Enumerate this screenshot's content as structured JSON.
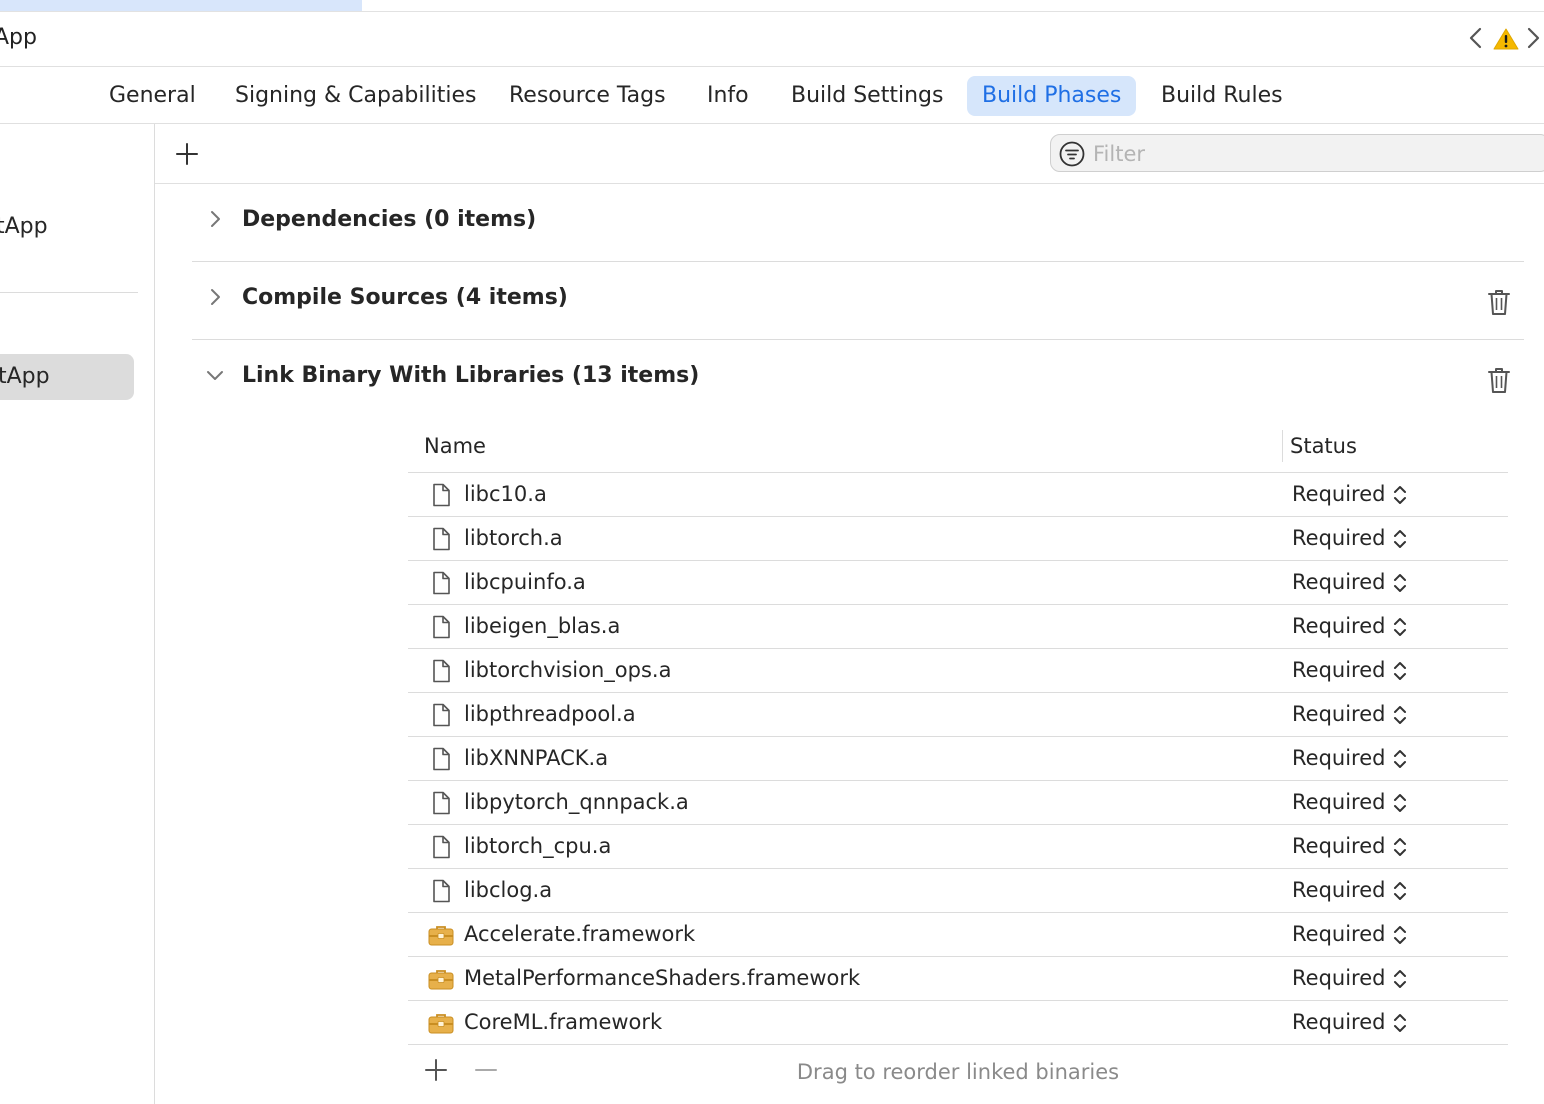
{
  "window": {
    "title": "App"
  },
  "tabs": [
    {
      "label": "General",
      "active": false
    },
    {
      "label": "Signing & Capabilities",
      "active": false
    },
    {
      "label": "Resource Tags",
      "active": false
    },
    {
      "label": "Info",
      "active": false
    },
    {
      "label": "Build Settings",
      "active": false
    },
    {
      "label": "Build Phases",
      "active": true
    },
    {
      "label": "Build Rules",
      "active": false
    }
  ],
  "sidebar": {
    "project_label": "tApp",
    "target_label": "tApp"
  },
  "toolbar": {
    "filter_placeholder": "Filter"
  },
  "phases": {
    "dependencies": {
      "title": "Dependencies (0 items)",
      "expanded": false
    },
    "compile_sources": {
      "title": "Compile Sources (4 items)",
      "expanded": false
    },
    "link_binary": {
      "title": "Link Binary With Libraries (13 items)",
      "expanded": true
    }
  },
  "library_table": {
    "columns": {
      "name": "Name",
      "status": "Status"
    },
    "rows": [
      {
        "name": "libc10.a",
        "status": "Required",
        "icon": "document-icon"
      },
      {
        "name": "libtorch.a",
        "status": "Required",
        "icon": "document-icon"
      },
      {
        "name": "libcpuinfo.a",
        "status": "Required",
        "icon": "document-icon"
      },
      {
        "name": "libeigen_blas.a",
        "status": "Required",
        "icon": "document-icon"
      },
      {
        "name": "libtorchvision_ops.a",
        "status": "Required",
        "icon": "document-icon"
      },
      {
        "name": "libpthreadpool.a",
        "status": "Required",
        "icon": "document-icon"
      },
      {
        "name": "libXNNPACK.a",
        "status": "Required",
        "icon": "document-icon"
      },
      {
        "name": "libpytorch_qnnpack.a",
        "status": "Required",
        "icon": "document-icon"
      },
      {
        "name": "libtorch_cpu.a",
        "status": "Required",
        "icon": "document-icon"
      },
      {
        "name": "libclog.a",
        "status": "Required",
        "icon": "document-icon"
      },
      {
        "name": "Accelerate.framework",
        "status": "Required",
        "icon": "framework-toolbox-icon"
      },
      {
        "name": "MetalPerformanceShaders.framework",
        "status": "Required",
        "icon": "framework-toolbox-icon"
      },
      {
        "name": "CoreML.framework",
        "status": "Required",
        "icon": "framework-toolbox-icon"
      }
    ],
    "footer_hint": "Drag to reorder linked binaries"
  },
  "colors": {
    "accent": "#1f6fe5",
    "active_tab_bg": "#d6e6fb",
    "warning": "#f5b800",
    "framework_icon": "#e2a93b"
  }
}
